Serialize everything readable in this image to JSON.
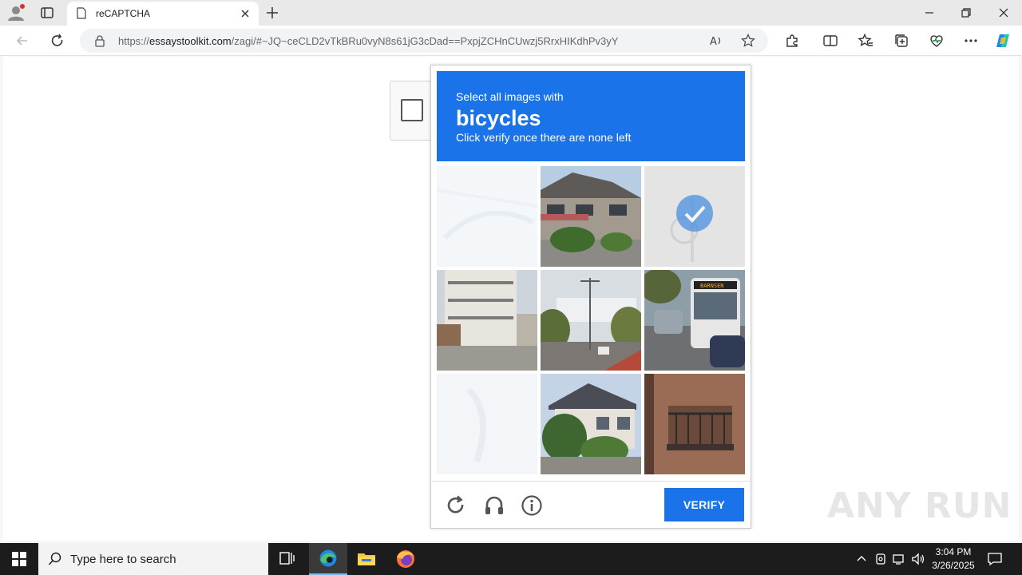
{
  "browser": {
    "tab_title": "reCAPTCHA",
    "url_prefix": "https://",
    "url_host": "essaystoolkit.com",
    "url_path": "/zagi/#~JQ~ceCLD2vTkBRu0vyN8s61jG3cDad==PxpjZCHnCUwzj5RrxHIKdhPv3yY"
  },
  "captcha": {
    "line1": "Select all images with",
    "keyword": "bicycles",
    "line3": "Click verify once there are none left",
    "verify_label": "VERIFY",
    "tiles": [
      {
        "state": "fading"
      },
      {
        "state": "image",
        "subject": "row houses street"
      },
      {
        "state": "selected"
      },
      {
        "state": "image",
        "subject": "apartment building"
      },
      {
        "state": "image",
        "subject": "street with lamp posts"
      },
      {
        "state": "image",
        "subject": "bus in traffic"
      },
      {
        "state": "fading"
      },
      {
        "state": "image",
        "subject": "house with trees"
      },
      {
        "state": "image",
        "subject": "balcony"
      }
    ],
    "bus_sign": "BARNSEN"
  },
  "watermark": "ANY RUN",
  "taskbar": {
    "search_placeholder": "Type here to search",
    "time": "3:04 PM",
    "date": "3/26/2025"
  },
  "colors": {
    "accent": "#1a73e8",
    "taskbar": "#1c1c1c"
  }
}
